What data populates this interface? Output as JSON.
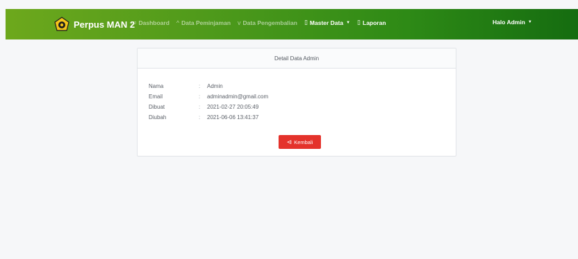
{
  "navbar": {
    "brand": "Perpus MAN 2",
    "items": [
      {
        "label": "Dashboard",
        "icon": "monitor-icon",
        "glyph": "▭"
      },
      {
        "label": "Data Peminjaman",
        "icon": "chevron-up-icon",
        "glyph": "^"
      },
      {
        "label": "Data Pengembalian",
        "icon": "chevron-down-icon",
        "glyph": "v"
      },
      {
        "label": "Master Data",
        "icon": "book-icon",
        "glyph": "▯"
      },
      {
        "label": "Laporan",
        "icon": "document-icon",
        "glyph": "▯"
      }
    ],
    "user_greeting": "Halo Admin"
  },
  "card": {
    "title": "Detail Data Admin",
    "fields": [
      {
        "label": "Nama",
        "separator": ":",
        "value": "Admin"
      },
      {
        "label": "Email",
        "separator": ":",
        "value": "adminadmin@gmail.com"
      },
      {
        "label": "Dibuat",
        "separator": ":",
        "value": "2021-02-27 20:05:49"
      },
      {
        "label": "Diubah",
        "separator": ":",
        "value": "2021-06-06 13:41:37"
      }
    ],
    "back_button": "Kembali"
  },
  "colors": {
    "navbar_start": "#6da81c",
    "navbar_end": "#156c10",
    "danger": "#e4322b"
  }
}
